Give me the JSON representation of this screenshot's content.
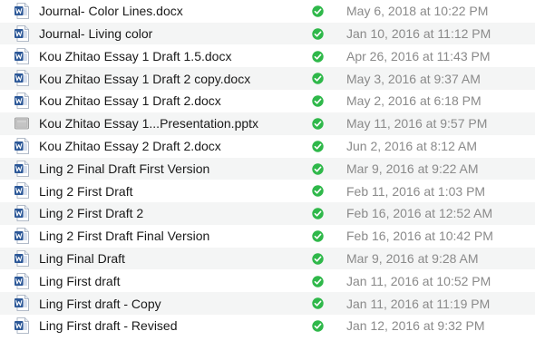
{
  "colors": {
    "word_blue": "#2b5797",
    "status_green": "#2fb84a",
    "alt_row": "#f4f5f5"
  },
  "files": [
    {
      "name": "Journal- Color Lines.docx",
      "icon": "word-doc-icon",
      "status": "synced-check-icon",
      "date": "May 6, 2018 at 10:22 PM"
    },
    {
      "name": "Journal- Living color",
      "icon": "word-doc-icon",
      "status": "synced-check-icon",
      "date": "Jan 10, 2016 at 11:12 PM"
    },
    {
      "name": "Kou Zhitao Essay 1 Draft 1.5.docx",
      "icon": "word-doc-icon",
      "status": "synced-check-icon",
      "date": "Apr 26, 2016 at 11:43 PM"
    },
    {
      "name": "Kou Zhitao Essay 1 Draft 2 copy.docx",
      "icon": "word-doc-icon",
      "status": "synced-check-icon",
      "date": "May 3, 2016 at 9:37 AM"
    },
    {
      "name": "Kou Zhitao Essay 1 Draft 2.docx",
      "icon": "word-doc-icon",
      "status": "synced-check-icon",
      "date": "May 2, 2016 at 6:18 PM"
    },
    {
      "name": "Kou Zhitao Essay 1...Presentation.pptx",
      "icon": "presentation-file-icon",
      "status": "synced-check-icon",
      "date": "May 11, 2016 at 9:57 PM"
    },
    {
      "name": "Kou Zhitao Essay 2 Draft 2.docx",
      "icon": "word-doc-icon",
      "status": "synced-check-icon",
      "date": "Jun 2, 2016 at 8:12 AM"
    },
    {
      "name": "Ling 2 Final Draft First Version",
      "icon": "word-doc-icon",
      "status": "synced-check-icon",
      "date": "Mar 9, 2016 at 9:22 AM"
    },
    {
      "name": "Ling 2 First Draft",
      "icon": "word-doc-icon",
      "status": "synced-check-icon",
      "date": "Feb 11, 2016 at 1:03 PM"
    },
    {
      "name": "Ling 2 First Draft 2",
      "icon": "word-doc-icon",
      "status": "synced-check-icon",
      "date": "Feb 16, 2016 at 12:52 AM"
    },
    {
      "name": "Ling 2 First Draft Final Version",
      "icon": "word-doc-icon",
      "status": "synced-check-icon",
      "date": "Feb 16, 2016 at 10:42 PM"
    },
    {
      "name": "Ling Final Draft",
      "icon": "word-doc-icon",
      "status": "synced-check-icon",
      "date": "Mar 9, 2016 at 9:28 AM"
    },
    {
      "name": "Ling First draft",
      "icon": "word-doc-icon",
      "status": "synced-check-icon",
      "date": "Jan 11, 2016 at 10:52 PM"
    },
    {
      "name": "Ling First draft - Copy",
      "icon": "word-doc-icon",
      "status": "synced-check-icon",
      "date": "Jan 11, 2016 at 11:19 PM"
    },
    {
      "name": "Ling First draft - Revised",
      "icon": "word-doc-icon",
      "status": "synced-check-icon",
      "date": "Jan 12, 2016 at 9:32 PM"
    }
  ]
}
